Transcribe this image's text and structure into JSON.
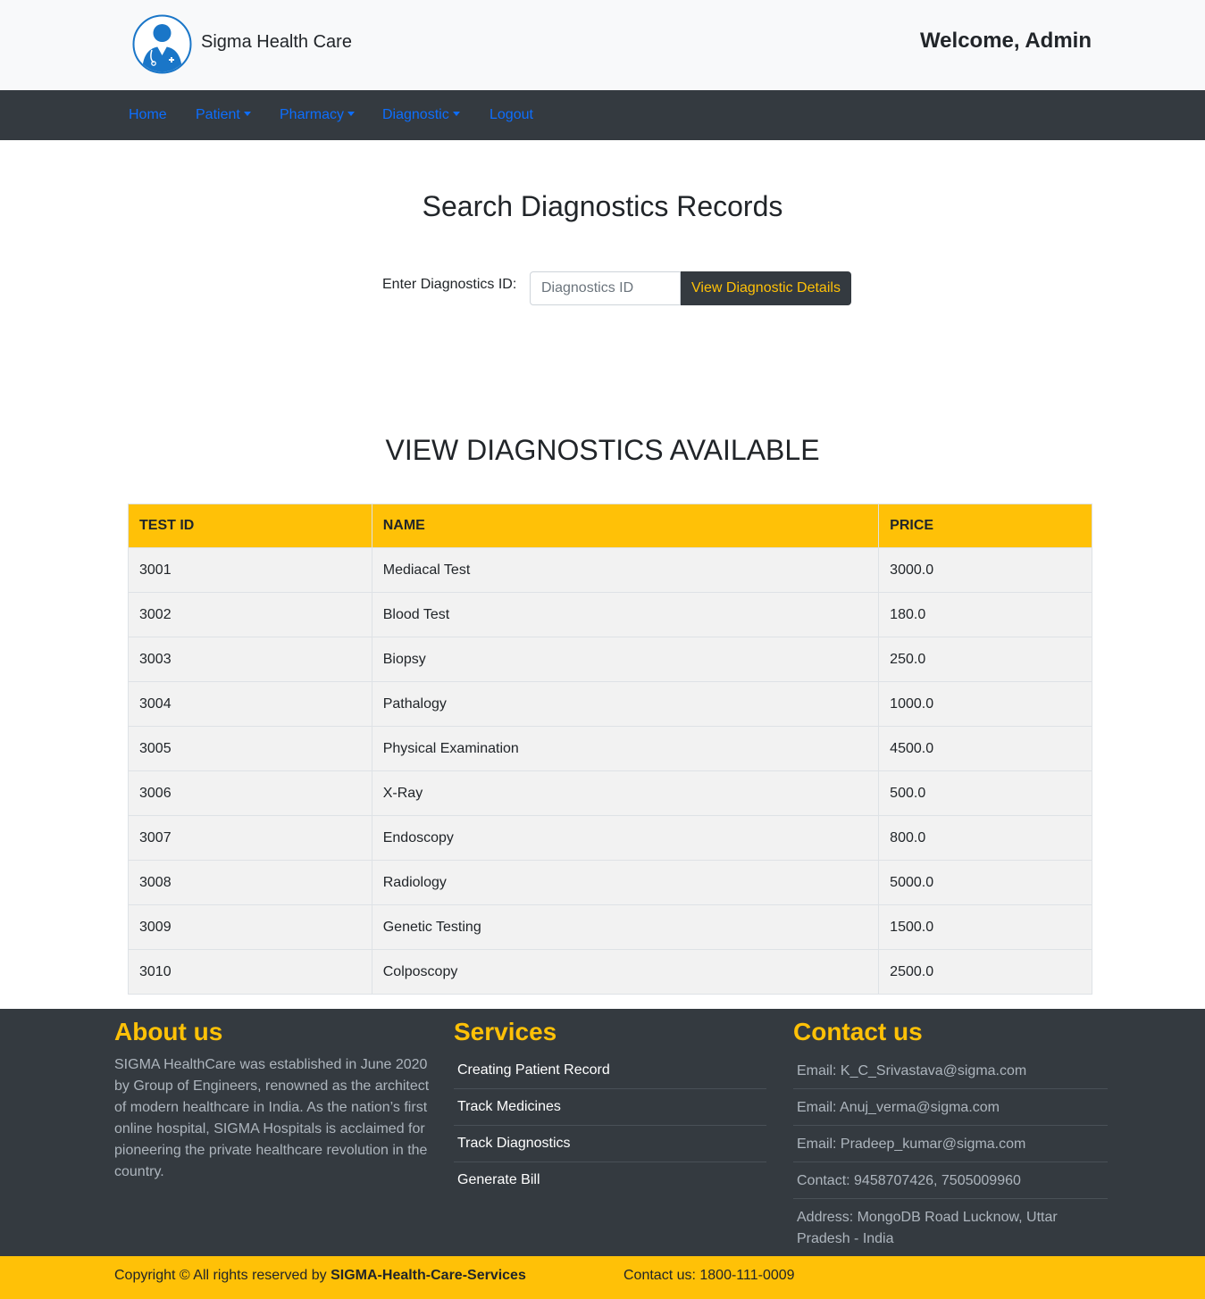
{
  "header": {
    "brand": "Sigma Health Care",
    "welcome": "Welcome, Admin"
  },
  "nav": {
    "home": "Home",
    "patient": "Patient",
    "pharmacy": "Pharmacy",
    "diagnostic": "Diagnostic",
    "logout": "Logout"
  },
  "search": {
    "title": "Search Diagnostics Records",
    "label": "Enter Diagnostics ID:",
    "placeholder": "Diagnostics ID",
    "value": "",
    "button": "View Diagnostic Details"
  },
  "table": {
    "title": "VIEW DIAGNOSTICS AVAILABLE",
    "columns": [
      "TEST ID",
      "NAME",
      "PRICE"
    ],
    "rows": [
      [
        "3001",
        "Mediacal Test",
        "3000.0"
      ],
      [
        "3002",
        "Blood Test",
        "180.0"
      ],
      [
        "3003",
        "Biopsy",
        "250.0"
      ],
      [
        "3004",
        "Pathalogy",
        "1000.0"
      ],
      [
        "3005",
        "Physical Examination",
        "4500.0"
      ],
      [
        "3006",
        "X-Ray",
        "500.0"
      ],
      [
        "3007",
        "Endoscopy",
        "800.0"
      ],
      [
        "3008",
        "Radiology",
        "5000.0"
      ],
      [
        "3009",
        "Genetic Testing",
        "1500.0"
      ],
      [
        "3010",
        "Colposcopy",
        "2500.0"
      ]
    ]
  },
  "footer": {
    "about": {
      "heading": "About us",
      "text": "SIGMA HealthCare was established in June 2020 by Group of Engineers, renowned as the architect of modern healthcare in India. As the nation’s first online hospital, SIGMA Hospitals is acclaimed for pioneering the private healthcare revolution in the country."
    },
    "services": {
      "heading": "Services",
      "items": [
        "Creating Patient Record",
        "Track Medicines",
        "Track Diagnostics",
        "Generate Bill"
      ]
    },
    "contact": {
      "heading": "Contact us",
      "items": [
        "Email: K_C_Srivastava@sigma.com",
        "Email: Anuj_verma@sigma.com",
        "Email: Pradeep_kumar@sigma.com",
        "Contact: 9458707426, 7505009960",
        "Address: MongoDB Road Lucknow, Uttar Pradesh - India"
      ]
    }
  },
  "bottom": {
    "copyright_prefix": "Copyright © All rights reserved by ",
    "copyright_org": "SIGMA-Health-Care-Services",
    "contact": "Contact us: 1800-111-0009"
  },
  "colors": {
    "accent": "#ffc107",
    "dark": "#343a40",
    "link": "#0d6efd",
    "logo_blue": "#1a76c8"
  },
  "icons": {
    "logo": "doctor-avatar-icon",
    "dropdown": "caret-down-icon"
  }
}
